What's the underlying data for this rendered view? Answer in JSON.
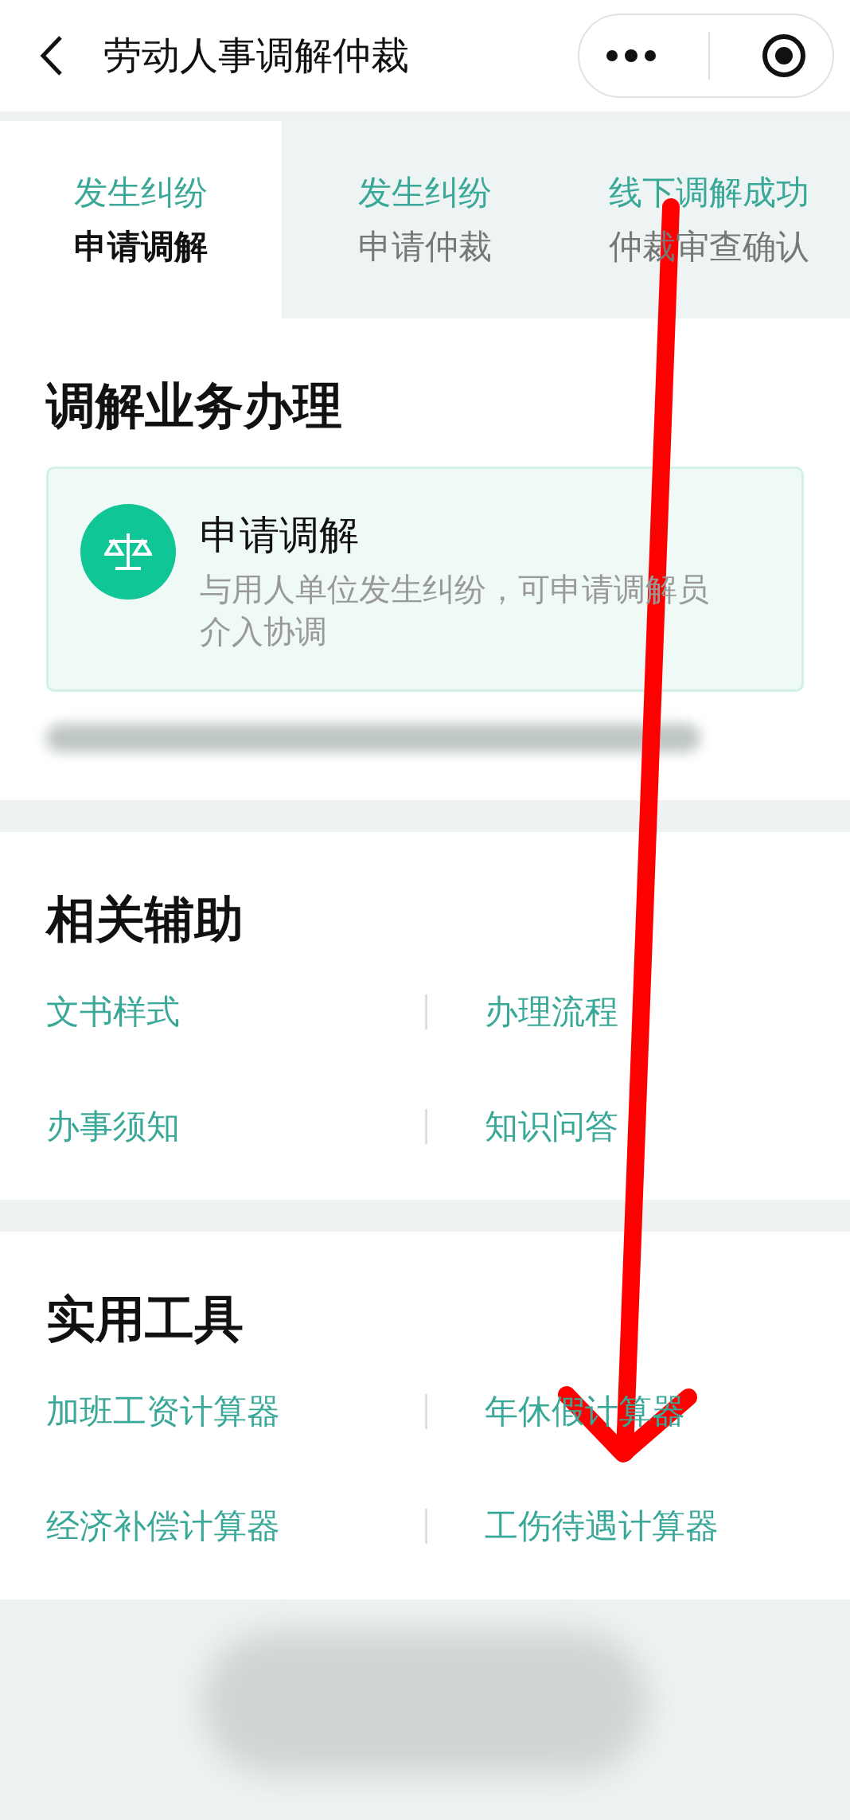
{
  "header": {
    "title": "劳动人事调解仲裁"
  },
  "tabs": [
    {
      "line1": "发生纠纷",
      "line2": "申请调解",
      "selected": true
    },
    {
      "line1": "发生纠纷",
      "line2": "申请仲裁",
      "selected": false
    },
    {
      "line1": "线下调解成功",
      "line2": "仲裁审查确认",
      "selected": false
    }
  ],
  "mediation": {
    "title": "调解业务办理",
    "card": {
      "title": "申请调解",
      "description": "与用人单位发生纠纷，可申请调解员介入协调"
    }
  },
  "assist": {
    "title": "相关辅助",
    "links": [
      "文书样式",
      "办理流程",
      "办事须知",
      "知识问答"
    ]
  },
  "tools": {
    "title": "实用工具",
    "links": [
      "加班工资计算器",
      "年休假计算器",
      "经济补偿计算器",
      "工伤待遇计算器"
    ]
  }
}
